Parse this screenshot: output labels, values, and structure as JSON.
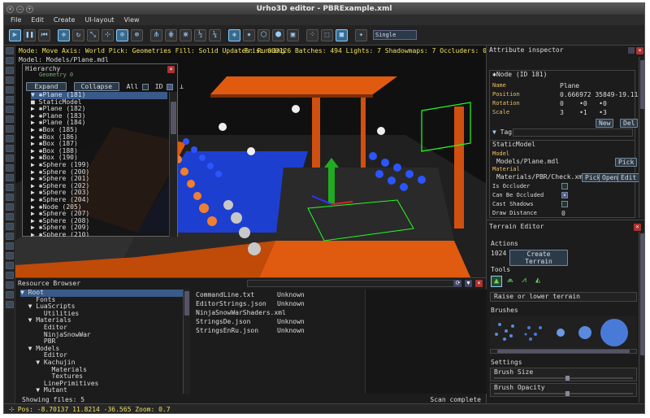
{
  "window": {
    "title": "Urho3D editor - PBRExample.xml"
  },
  "menu": {
    "items": [
      "File",
      "Edit",
      "Create",
      "UI-layout",
      "View"
    ]
  },
  "toolbar": {
    "mode_value": "Single"
  },
  "viewport": {
    "status": "Mode: Move  Axis: World  Pick: Geometries  Fill: Solid  Updates: Running",
    "stats": "Tris: 600126  Batches: 494  Lights: 7  Shadowmaps: 7  Occluders: 0",
    "model": "Model: Models/Plane.mdl"
  },
  "hierarchy": {
    "title": "Hierarchy",
    "ghost": "Geometry 0",
    "expand": "Expand",
    "collapse": "Collapse",
    "all": "All",
    "id": "ID",
    "rows": [
      "▼ ✱Plane (181)",
      "    ■ StaticModel",
      "▶ ✱Plane (182)",
      "▶ ✱Plane (183)",
      "▶ ✱Plane (184)",
      "▶ ✱Box (185)",
      "▶ ✱Box (186)",
      "▶ ✱Box (187)",
      "▶ ✱Box (188)",
      "▶ ✱Box (190)",
      "▶ ✱Sphere (199)",
      "▶ ✱Sphere (200)",
      "▶ ✱Sphere (201)",
      "▶ ✱Sphere (202)",
      "▶ ✱Sphere (203)",
      "▶ ✱Sphere (204)",
      "▶ ✱Node (205)",
      "▶ ✱Sphere (207)",
      "▶ ✱Sphere (208)",
      "▶ ✱Sphere (209)",
      "▶ ✱Sphere (210)"
    ]
  },
  "attr": {
    "title": "Attribute inspector",
    "node_title": "✱Node (ID 181)",
    "name_label": "Name",
    "name_value": "Plane",
    "position_label": "Position",
    "position_value": "0.666972 35849-19.115",
    "rotation_label": "Rotation",
    "rotation_value": "0    •0   •0",
    "scale_label": "Scale",
    "scale_value": "3    •1   •3",
    "new": "New",
    "del": "Del",
    "tags": "Tags",
    "component": "StaticModel",
    "model_label": "Model",
    "model_value": "Models/Plane.mdl",
    "pick": "Pick",
    "material_label": "Material",
    "material_value": "Materials/PBR/Check.xm",
    "open": "Open",
    "edit": "Edit",
    "occluder": "Is Occluder",
    "occluded": "Can Be Occluded",
    "shadows": "Cast Shadows",
    "draw_label": "Draw Distance",
    "draw_value": "0"
  },
  "terrain": {
    "title": "Terrain Editor",
    "actions": "Actions",
    "size": "1024",
    "create": "Create Terrain",
    "tools": "Tools",
    "tool_desc": "Raise or lower terrain",
    "brushes": "Brushes",
    "settings": "Settings",
    "brush_size": "Brush Size",
    "brush_opacity": "Brush Opacity"
  },
  "resources": {
    "title": "Resource Browser",
    "tree": [
      "▼ Root",
      "    Fonts",
      "  ▼ LuaScripts",
      "      Utilities",
      "  ▼ Materials",
      "      Editor",
      "      NinjaSnowWar",
      "      PBR",
      "  ▼ Models",
      "      Editor",
      "    ▼ Kachujin",
      "        Materials",
      "        Textures",
      "      LinePrimitives",
      "    ▼ Mutant"
    ],
    "files": [
      [
        "CommandLine.txt",
        "Unknown"
      ],
      [
        "EditorStrings.json",
        "Unknown"
      ],
      [
        "NinjaSnowWarShaders.xml",
        ""
      ],
      [
        "StringsDe.json",
        "Unknown"
      ],
      [
        "StringsEnRu.json",
        "Unknown"
      ]
    ],
    "showing": "Showing files: 5",
    "scan": "Scan complete"
  },
  "status": {
    "text": "Pos: -8.70137 11.8214  -36.565  Zoom: 0.7"
  }
}
